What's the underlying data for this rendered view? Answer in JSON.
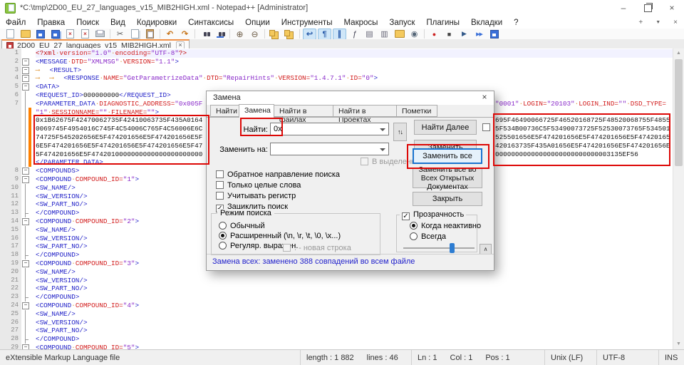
{
  "window": {
    "title": "*C:\\tmp\\2D00_EU_27_languages_v15_MIB2HIGH.xml - Notepad++ [Administrator]",
    "minimize_glyph": "–",
    "close_glyph": "×"
  },
  "menu": {
    "items": [
      "Файл",
      "Правка",
      "Поиск",
      "Вид",
      "Кодировки",
      "Синтаксисы",
      "Опции",
      "Инструменты",
      "Макросы",
      "Запуск",
      "Плагины",
      "Вкладки",
      "?"
    ],
    "new_tab_glyph": "+",
    "tab_list_glyph": "▼",
    "close_tab_glyph": "×"
  },
  "toolbar": {
    "icons": [
      {
        "name": "new-file-icon",
        "glyph": ""
      },
      {
        "name": "open-icon",
        "glyph": ""
      },
      {
        "name": "save-icon",
        "glyph": ""
      },
      {
        "name": "save-all-icon",
        "glyph": ""
      },
      {
        "name": "close-icon",
        "glyph": "×"
      },
      {
        "name": "close-all-icon",
        "glyph": "×"
      },
      {
        "name": "print-icon",
        "glyph": ""
      },
      {
        "name": "sep"
      },
      {
        "name": "cut-icon",
        "glyph": "✂"
      },
      {
        "name": "copy-icon",
        "glyph": ""
      },
      {
        "name": "paste-icon",
        "glyph": ""
      },
      {
        "name": "sep"
      },
      {
        "name": "undo-icon",
        "glyph": "↶"
      },
      {
        "name": "redo-icon",
        "glyph": "↷"
      },
      {
        "name": "sep"
      },
      {
        "name": "find-icon",
        "glyph": ""
      },
      {
        "name": "replace-icon",
        "glyph": ""
      },
      {
        "name": "sep"
      },
      {
        "name": "zoom-in-icon",
        "glyph": "⊕"
      },
      {
        "name": "zoom-out-icon",
        "glyph": "⊖"
      },
      {
        "name": "sep"
      },
      {
        "name": "sync-vertical-icon",
        "glyph": ""
      },
      {
        "name": "sync-horizontal-icon",
        "glyph": ""
      },
      {
        "name": "sep"
      },
      {
        "name": "word-wrap-icon",
        "glyph": "↩",
        "pressed": true
      },
      {
        "name": "show-all-characters-icon",
        "glyph": "¶",
        "pressed": true
      },
      {
        "name": "indent-guide-icon",
        "glyph": "∥",
        "pressed": true
      },
      {
        "name": "function-list-icon",
        "glyph": "ƒ"
      },
      {
        "name": "document-map-icon",
        "glyph": "▤"
      },
      {
        "name": "document-list-icon",
        "glyph": "▥"
      },
      {
        "name": "folder-as-workspace-icon",
        "glyph": ""
      },
      {
        "name": "monitoring-icon",
        "glyph": "◉"
      },
      {
        "name": "sep"
      },
      {
        "name": "macro-record-icon",
        "glyph": "●"
      },
      {
        "name": "macro-stop-icon",
        "glyph": "■"
      },
      {
        "name": "macro-play-icon",
        "glyph": "▶"
      },
      {
        "name": "macro-run-multiple-icon",
        "glyph": "▶▶"
      },
      {
        "name": "macro-save-icon",
        "glyph": ""
      }
    ]
  },
  "tab": {
    "label": "2D00_EU_27_languages_v15_MIB2HIGH.xml",
    "close_glyph": "×"
  },
  "editor": {
    "rows": [
      {
        "n": "1",
        "hl": true,
        "seg": [
          [
            "p",
            "<?xml"
          ],
          [
            "w",
            "·"
          ],
          [
            "a",
            "version="
          ],
          [
            "v",
            "\"1.0\""
          ],
          [
            "w",
            "·"
          ],
          [
            "a",
            "encoding="
          ],
          [
            "v",
            "\"UTF-8\""
          ],
          [
            "p",
            "?>"
          ]
        ]
      },
      {
        "n": "2",
        "f": "box",
        "seg": [
          [
            "t",
            "<MESSAGE"
          ],
          [
            "w",
            "·"
          ],
          [
            "a",
            "DTD="
          ],
          [
            "v",
            "\"XMLMSG\""
          ],
          [
            "w",
            "·"
          ],
          [
            "a",
            "VERSION="
          ],
          [
            "v",
            "\"1.1\""
          ],
          [
            "t",
            ">"
          ]
        ]
      },
      {
        "n": "3",
        "f": "box",
        "seg": [
          [
            "tb",
            "⟶"
          ],
          [
            "t",
            "<RESULT>"
          ]
        ]
      },
      {
        "n": "4",
        "f": "box",
        "seg": [
          [
            "tb",
            "⟶"
          ],
          [
            "tb",
            "⟶"
          ],
          [
            "t",
            "<RESPONSE"
          ],
          [
            "w",
            "·"
          ],
          [
            "a",
            "NAME="
          ],
          [
            "v",
            "\"GetParametrizeData\""
          ],
          [
            "w",
            "·"
          ],
          [
            "a",
            "DTD="
          ],
          [
            "v",
            "\"RepairHints\""
          ],
          [
            "w",
            "·"
          ],
          [
            "a",
            "VERSION="
          ],
          [
            "v",
            "\"1.4.7.1\""
          ],
          [
            "w",
            "·"
          ],
          [
            "a",
            "ID="
          ],
          [
            "v",
            "\"0\""
          ],
          [
            "t",
            ">"
          ]
        ]
      },
      {
        "n": "5",
        "f": "box",
        "seg": [
          [
            "t",
            "<DATA>"
          ]
        ]
      },
      {
        "n": "6",
        "f": "line",
        "seg": [
          [
            "t",
            "<REQUEST_ID>"
          ],
          [
            "x",
            "000000000"
          ],
          [
            "t",
            "</REQUEST_ID>"
          ]
        ]
      },
      {
        "n": "7",
        "f": "line",
        "seg": [
          [
            "t",
            "<PARAMETER_DATA"
          ],
          [
            "w",
            "·"
          ],
          [
            "a",
            "DIAGNOSTIC_ADDRESS="
          ],
          [
            "v",
            "\"0x005F"
          ]
        ],
        "right": [
          [
            "v",
            "\"0001\""
          ],
          [
            "w",
            "·"
          ],
          [
            "a",
            "LOGIN="
          ],
          [
            "v",
            "\"20103\""
          ],
          [
            "w",
            "·"
          ],
          [
            "a",
            "LOGIN_IND="
          ],
          [
            "v",
            "\"\""
          ],
          [
            "w",
            "·"
          ],
          [
            "a",
            "DSD_TYPE="
          ]
        ]
      },
      {
        "n": "",
        "f": "line",
        "seg": [
          [
            "v",
            "\"1\""
          ],
          [
            "w",
            "·"
          ],
          [
            "a",
            "SESSIONNAME="
          ],
          [
            "v",
            "\"\""
          ],
          [
            "w",
            "·"
          ],
          [
            "a",
            "FILENAME="
          ],
          [
            "v",
            "\"\""
          ],
          [
            "t",
            ">"
          ]
        ]
      },
      {
        "n": "",
        "f": "line",
        "seg": [
          [
            "x",
            "0x1B62675F42470062735F42410063735F435A0164"
          ]
        ],
        "right": [
          [
            "x",
            "695F46490066725F46520168725F48520068755F4855"
          ]
        ]
      },
      {
        "n": "",
        "f": "line",
        "seg": [
          [
            "x",
            "0069745F4954016C745F4C54006C765F4C56006E6C"
          ]
        ],
        "right": [
          [
            "x",
            "5F534B00736C5F53490073725F52530073765F534501"
          ]
        ]
      },
      {
        "n": "",
        "f": "line",
        "seg": [
          [
            "x",
            "74725F545202656E5F474201656E5F474201656E5F"
          ]
        ],
        "right": [
          [
            "x",
            "525501656E5F474201656E5F474201656E5F47420165"
          ]
        ]
      },
      {
        "n": "",
        "f": "line",
        "seg": [
          [
            "x",
            "6E5F474201656E5F474201656E5F474201656E5F47"
          ]
        ],
        "right": [
          [
            "x",
            "420163735F435A01656E5F474201656E5F474201656E"
          ]
        ]
      },
      {
        "n": "",
        "f": "line",
        "seg": [
          [
            "x",
            "5F474201656E5F4742010000000000000000000000"
          ]
        ],
        "right": [
          [
            "x",
            "00000000000000000000000000003135EF56"
          ]
        ]
      },
      {
        "n": "",
        "f": "line",
        "seg": [
          [
            "t",
            "</PARAMETER_DATA>"
          ]
        ]
      },
      {
        "n": "8",
        "f": "box",
        "seg": [
          [
            "t",
            "<COMPOUNDS>"
          ]
        ]
      },
      {
        "n": "9",
        "f": "box",
        "seg": [
          [
            "t",
            "<COMPOUND"
          ],
          [
            "w",
            "·"
          ],
          [
            "a",
            "COMPOUND_ID="
          ],
          [
            "v",
            "\"1\""
          ],
          [
            "t",
            ">"
          ]
        ]
      },
      {
        "n": "10",
        "f": "line",
        "seg": [
          [
            "t",
            "<SW_NAME/>"
          ]
        ]
      },
      {
        "n": "11",
        "f": "line",
        "seg": [
          [
            "t",
            "<SW_VERSION/>"
          ]
        ]
      },
      {
        "n": "12",
        "f": "line",
        "seg": [
          [
            "t",
            "<SW_PART_NO/>"
          ]
        ]
      },
      {
        "n": "13",
        "f": "end",
        "seg": [
          [
            "t",
            "</COMPOUND>"
          ]
        ]
      },
      {
        "n": "14",
        "f": "box",
        "seg": [
          [
            "t",
            "<COMPOUND"
          ],
          [
            "w",
            "·"
          ],
          [
            "a",
            "COMPOUND_ID="
          ],
          [
            "v",
            "\"2\""
          ],
          [
            "t",
            ">"
          ]
        ]
      },
      {
        "n": "15",
        "f": "line",
        "seg": [
          [
            "t",
            "<SW_NAME/>"
          ]
        ]
      },
      {
        "n": "16",
        "f": "line",
        "seg": [
          [
            "t",
            "<SW_VERSION/>"
          ]
        ]
      },
      {
        "n": "17",
        "f": "line",
        "seg": [
          [
            "t",
            "<SW_PART_NO/>"
          ]
        ]
      },
      {
        "n": "18",
        "f": "end",
        "seg": [
          [
            "t",
            "</COMPOUND>"
          ]
        ]
      },
      {
        "n": "19",
        "f": "box",
        "seg": [
          [
            "t",
            "<COMPOUND"
          ],
          [
            "w",
            "·"
          ],
          [
            "a",
            "COMPOUND_ID="
          ],
          [
            "v",
            "\"3\""
          ],
          [
            "t",
            ">"
          ]
        ]
      },
      {
        "n": "20",
        "f": "line",
        "seg": [
          [
            "t",
            "<SW_NAME/>"
          ]
        ]
      },
      {
        "n": "21",
        "f": "line",
        "seg": [
          [
            "t",
            "<SW_VERSION/>"
          ]
        ]
      },
      {
        "n": "22",
        "f": "line",
        "seg": [
          [
            "t",
            "<SW_PART_NO/>"
          ]
        ]
      },
      {
        "n": "23",
        "f": "end",
        "seg": [
          [
            "t",
            "</COMPOUND>"
          ]
        ]
      },
      {
        "n": "24",
        "f": "box",
        "seg": [
          [
            "t",
            "<COMPOUND"
          ],
          [
            "w",
            "·"
          ],
          [
            "a",
            "COMPOUND_ID="
          ],
          [
            "v",
            "\"4\""
          ],
          [
            "t",
            ">"
          ]
        ]
      },
      {
        "n": "25",
        "f": "line",
        "seg": [
          [
            "t",
            "<SW_NAME/>"
          ]
        ]
      },
      {
        "n": "26",
        "f": "line",
        "seg": [
          [
            "t",
            "<SW_VERSION/>"
          ]
        ]
      },
      {
        "n": "27",
        "f": "line",
        "seg": [
          [
            "t",
            "<SW_PART_NO/>"
          ]
        ]
      },
      {
        "n": "28",
        "f": "end",
        "seg": [
          [
            "t",
            "</COMPOUND>"
          ]
        ]
      },
      {
        "n": "29",
        "f": "box",
        "seg": [
          [
            "t",
            "<COMPOUND"
          ],
          [
            "w",
            "·"
          ],
          [
            "a",
            "COMPOUND_ID="
          ],
          [
            "v",
            "\"5\""
          ],
          [
            "t",
            ">"
          ]
        ]
      }
    ]
  },
  "dialog": {
    "title": "Замена",
    "close_glyph": "×",
    "tabs": [
      {
        "label": "Найти",
        "active": false
      },
      {
        "label": "Замена",
        "active": true
      },
      {
        "label": "Найти в файлах",
        "active": false
      },
      {
        "label": "Найти в Проектах",
        "active": false
      },
      {
        "label": "Пометки",
        "active": false
      }
    ],
    "find_label": "Найти:",
    "find_value": "0x",
    "replace_label": "Заменить на:",
    "replace_value": "",
    "swap_glyph": "↑↓",
    "find_next_btn": "Найти Далее",
    "replace_btn": "Заменить",
    "replace_all_btn": "Заменить все",
    "replace_all_open_btn": "Заменить все во Всех Открытых Документах",
    "close_btn": "Закрыть",
    "collapse_glyph": "∧",
    "in_selection": {
      "label": "В выделенном",
      "checked": false,
      "enabled": false
    },
    "options": [
      {
        "label": "Обратное направление поиска",
        "checked": false
      },
      {
        "label": "Только целые слова",
        "checked": false
      },
      {
        "label": "Учитывать регистр",
        "checked": false
      },
      {
        "label": "Зациклить поиск",
        "checked": true
      }
    ],
    "search_mode": {
      "title": "Режим поиска",
      "radios": [
        {
          "label": "Обычный",
          "selected": false
        },
        {
          "label": "Расширенный (\\n, \\r, \\t, \\0, \\x...)",
          "selected": true
        },
        {
          "label": "Регуляр. выражен.",
          "selected": false
        }
      ],
      "newline_option": {
        "label": ". - новая строка",
        "checked": false,
        "enabled": false
      }
    },
    "transparency": {
      "title": "Прозрачность",
      "checked": true,
      "radios": [
        {
          "label": "Когда неактивно",
          "selected": true
        },
        {
          "label": "Всегда",
          "selected": false
        }
      ],
      "slider_percent": 66
    },
    "status": "Замена всех: заменено 388 совпадений во всем файле"
  },
  "statusbar": {
    "doc_type": "eXtensible Markup Language file",
    "length": "length : 1 882",
    "lines": "lines : 46",
    "ln": "Ln : 1",
    "col": "Col : 1",
    "pos": "Pos : 1",
    "eol": "Unix (LF)",
    "encoding": "UTF-8",
    "mode": "INS"
  },
  "colors": {
    "annotation_red": "#dd0806",
    "modified_marker_orange": "#ff8000",
    "toggle_pressed_blue": "#cfe6f8",
    "status_message_blue": "#2222cc"
  }
}
